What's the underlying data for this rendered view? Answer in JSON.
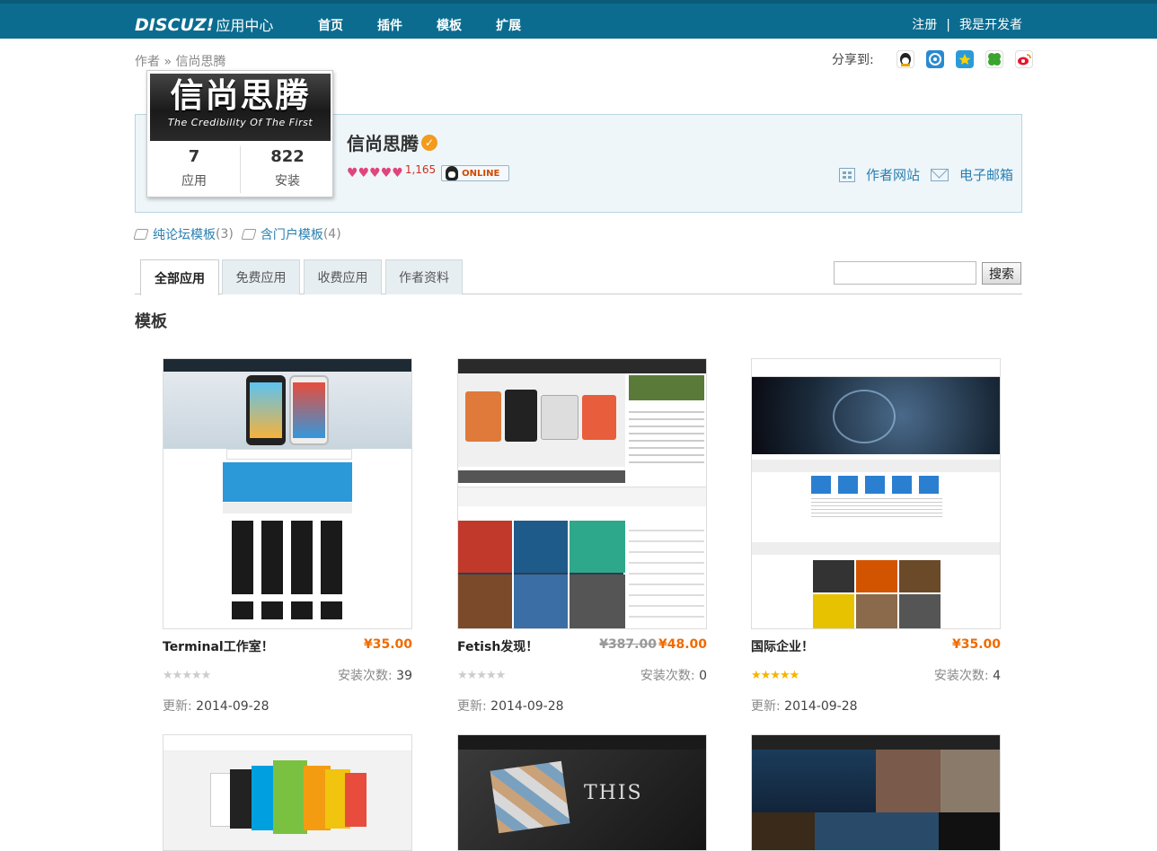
{
  "header": {
    "logo_main": "DISCUZ!",
    "logo_sub": "应用中心",
    "nav": [
      "首页",
      "插件",
      "模板",
      "扩展"
    ],
    "register": "注册",
    "separator": "|",
    "developer": "我是开发者"
  },
  "breadcrumb": {
    "root": "作者",
    "sep": "»",
    "current": "信尚思腾"
  },
  "share": {
    "label": "分享到:",
    "icons": [
      "qq-icon",
      "qzone-icon",
      "qq-star-icon",
      "clover-icon",
      "weibo-icon"
    ]
  },
  "author": {
    "banner_title": "信尚思腾",
    "banner_subtitle": "The Credibility Of The First",
    "name": "信尚思腾",
    "apps_count": "7",
    "apps_label": "应用",
    "installs_count": "822",
    "installs_label": "安装",
    "score": "1,165",
    "online": "ONLINE",
    "website": "作者网站",
    "email": "电子邮箱"
  },
  "tags": [
    {
      "label": "纯论坛模板",
      "count": "(3)"
    },
    {
      "label": "含门户模板",
      "count": "(4)"
    }
  ],
  "tabs": [
    "全部应用",
    "免费应用",
    "收费应用",
    "作者资料"
  ],
  "search": {
    "button": "搜索",
    "value": ""
  },
  "section_title": "模板",
  "items": [
    {
      "name": "Terminal工作室！",
      "price": "¥35.00",
      "old_price": "",
      "rating": 0,
      "installs_label": "安装次数:",
      "installs": "39",
      "updated_label": "更新:",
      "updated": "2014-09-28"
    },
    {
      "name": "Fetish发现！",
      "price": "¥48.00",
      "old_price": "¥387.00",
      "rating": 0,
      "installs_label": "安装次数:",
      "installs": "0",
      "updated_label": "更新:",
      "updated": "2014-09-28"
    },
    {
      "name": "国际企业！",
      "price": "¥35.00",
      "old_price": "",
      "rating": 5,
      "installs_label": "安装次数:",
      "installs": "4",
      "updated_label": "更新:",
      "updated": "2014-09-28"
    }
  ],
  "colors": {
    "topbar": "#0b6c8f",
    "price": "#f06a00",
    "link": "#2a7fb0"
  }
}
